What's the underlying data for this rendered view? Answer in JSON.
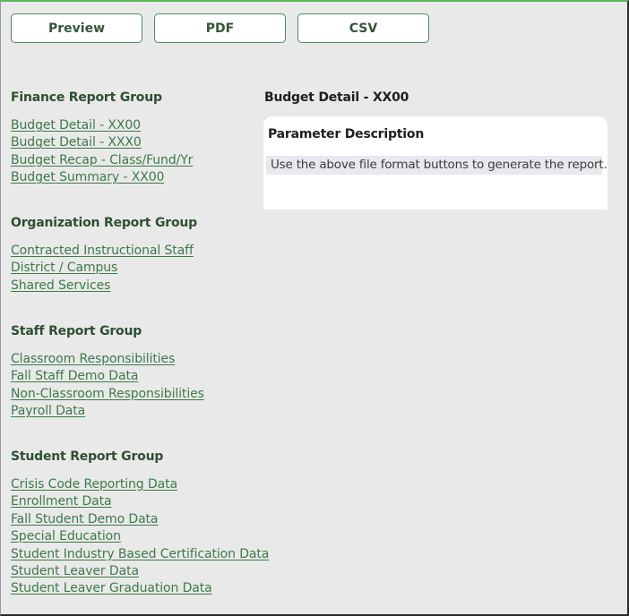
{
  "toolbar": {
    "preview_label": "Preview",
    "pdf_label": "PDF",
    "csv_label": "CSV"
  },
  "groups": [
    {
      "title": "Finance Report Group",
      "items": [
        "Budget Detail - XX00",
        "Budget Detail - XXX0",
        "Budget Recap - Class/Fund/Yr",
        "Budget Summary - XX00"
      ]
    },
    {
      "title": "Organization Report Group",
      "items": [
        "Contracted Instructional Staff",
        "District / Campus",
        "Shared Services"
      ]
    },
    {
      "title": "Staff Report Group",
      "items": [
        "Classroom Responsibilities",
        "Fall Staff Demo Data",
        "Non-Classroom Responsibilities",
        "Payroll Data"
      ]
    },
    {
      "title": "Student Report Group",
      "items": [
        "Crisis Code Reporting Data",
        "Enrollment Data",
        "Fall Student Demo Data",
        "Special Education",
        "Student Industry Based Certification Data",
        "Student Leaver Data",
        "Student Leaver Graduation Data"
      ]
    }
  ],
  "detail": {
    "title": "Budget Detail - XX00",
    "parameter_heading": "Parameter Description",
    "description": "Use the above file format buttons to generate the report."
  },
  "colors": {
    "accent": "#3c7a48",
    "heading": "#2f4f33",
    "top_border": "#5cb85c",
    "background": "#e9e9e9"
  }
}
